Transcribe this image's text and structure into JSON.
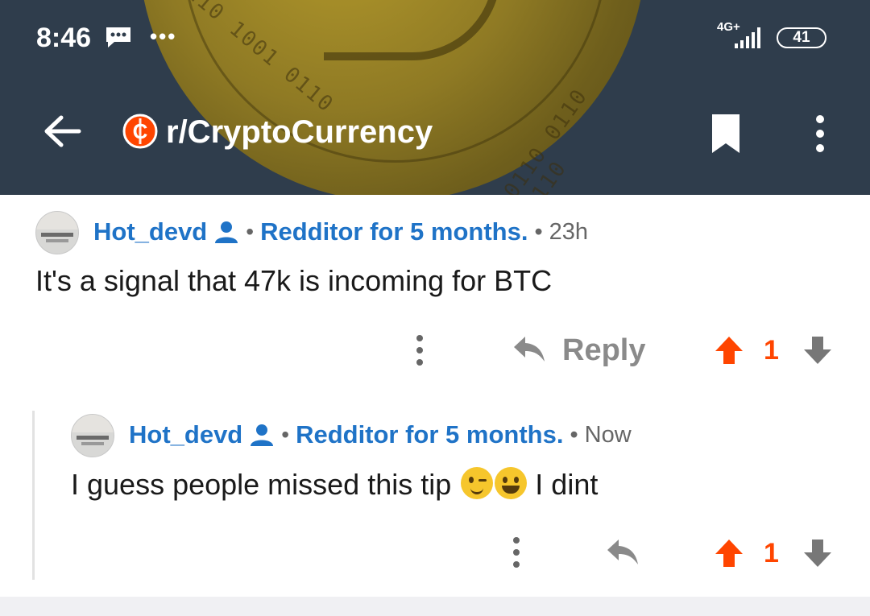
{
  "status_bar": {
    "time": "8:46",
    "network": "4G+",
    "battery": "41",
    "icons": [
      "message-icon",
      "more-notifications-icon",
      "signal-icon",
      "battery-icon"
    ]
  },
  "header": {
    "subreddit": "r/CryptoCurrency",
    "background_color": "#2f3d4c",
    "subreddit_icon_color": "#ff4500",
    "icons": [
      "back-arrow-icon",
      "subreddit-icon",
      "bookmark-icon",
      "more-vertical-icon"
    ]
  },
  "comments": [
    {
      "username": "Hot_devd",
      "separator": "•",
      "flair": "Redditor for 5 months.",
      "time": "• 23h",
      "body": "It's a signal that 47k is incoming for BTC",
      "reply_label": "Reply",
      "votes": "1"
    },
    {
      "username": "Hot_devd",
      "separator": "•",
      "flair": "Redditor for 5 months.",
      "time": "• Now",
      "body_before": "I guess people missed this tip",
      "emojis": [
        "winking-face",
        "grinning-face"
      ],
      "body_after": "I dint",
      "votes": "1"
    }
  ],
  "colors": {
    "link_blue": "#1f73c7",
    "upvote_orange": "#ff4500",
    "action_gray": "#8a8a8a"
  }
}
